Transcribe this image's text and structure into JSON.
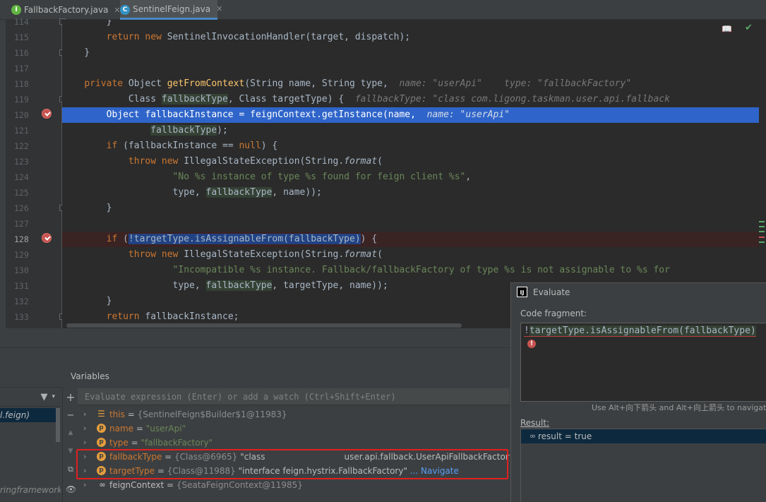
{
  "tabs": [
    {
      "label": "FallbackFactory.java",
      "icon": "interface-icon",
      "icon_letter": "I"
    },
    {
      "label": "SentinelFeign.java",
      "icon": "class-icon",
      "icon_letter": "C"
    }
  ],
  "editor": {
    "line_numbers": [
      "114",
      "115",
      "116",
      "117",
      "118",
      "119",
      "120",
      "121",
      "122",
      "123",
      "124",
      "125",
      "126",
      "127",
      "128",
      "129",
      "130",
      "131",
      "132",
      "133"
    ],
    "current_line": "128",
    "executing_line": "120",
    "breakpoint_lines": [
      "120",
      "128"
    ],
    "code": {
      "l114": "        }",
      "l115a": "        ",
      "l115b": "return",
      "l115c": " ",
      "l115d": "new",
      "l115e": " SentinelInvocationHandler(target, dispatch);",
      "l116": "    }",
      "l118a": "    ",
      "l118b": "private",
      "l118c": " Object ",
      "l118d": "getFromContext",
      "l118e": "(String name, String type,  ",
      "l118f": "name: \"userApi\"    type: \"fallbackFactory\"",
      "l119a": "            Class ",
      "l119b": "fallbackType",
      "l119c": ", Class targetType) {  ",
      "l119d": "fallbackType: \"class com.ligong.taskman.user.api.fallback",
      "l120a": "        Object ",
      "l120b": "fallbackInstance",
      "l120c": " = ",
      "l120d": "feignContext",
      "l120e": ".getInstance(name,  ",
      "l120f": "name: \"userApi\"",
      "l121a": "                ",
      "l121b": "fallbackType",
      "l121c": ");",
      "l122a": "        ",
      "l122b": "if",
      "l122c": " (fallbackInstance == ",
      "l122d": "null",
      "l122e": ") {",
      "l123a": "            ",
      "l123b": "throw",
      "l123c": " ",
      "l123d": "new",
      "l123e": " IllegalStateException(String.",
      "l123f": "format",
      "l123g": "(",
      "l124a": "                    ",
      "l124b": "\"No %s instance of type %s found for feign client %s\"",
      "l124c": ",",
      "l125a": "                    type, ",
      "l125b": "fallbackType",
      "l125c": ", name));",
      "l126": "        }",
      "l128a": "        ",
      "l128b": "if",
      "l128c": " (",
      "l128d": "!targetType.isAssignableFrom(fallbackType)",
      "l128e": ") {",
      "l129a": "            ",
      "l129b": "throw",
      "l129c": " ",
      "l129d": "new",
      "l129e": " IllegalStateException(String.",
      "l129f": "format",
      "l129g": "(",
      "l130a": "                    ",
      "l130b": "\"Incompatible %s instance. Fallback/fallbackFactory of type %s is not assignable to %s for",
      "l131a": "                    type, ",
      "l131b": "fallbackType",
      "l131c": ", targetType, name));",
      "l132": "        }",
      "l133a": "        ",
      "l133b": "return",
      "l133c": " fallbackInstance;"
    }
  },
  "debug": {
    "variables_title": "Variables",
    "watch_placeholder": "Evaluate expression (Enter) or add a watch (Ctrl+Shift+Enter)",
    "frame_label": "l.feign)",
    "frame_label2": "ringframework",
    "variables": [
      {
        "icon": "field-lines-icon",
        "name": "this",
        "type": "{SentinelFeign$Builder$1@11983}",
        "value": ""
      },
      {
        "icon": "parameter-icon",
        "name": "name",
        "type": "",
        "value": "\"userApi\""
      },
      {
        "icon": "parameter-icon",
        "name": "type",
        "type": "",
        "value": "\"fallbackFactory\""
      },
      {
        "icon": "parameter-icon",
        "name": "fallbackType",
        "type": "{Class@6965}",
        "value": "\"class",
        "value2": "user.api.fallback.UserApiFallbackFactory\""
      },
      {
        "icon": "parameter-icon",
        "name": "targetType",
        "type": "{Class@11988}",
        "value": "\"interface feign.hystrix.FallbackFactory\"",
        "link": "... Navigate"
      },
      {
        "icon": "watch-glasses-icon",
        "name": "feignContext",
        "type": "{SeataFeignContext@11985}",
        "value": ""
      }
    ]
  },
  "evaluate": {
    "title": "Evaluate",
    "code_label": "Code fragment:",
    "code_prefix": "!",
    "code_rest": "targetType.isAssignableFrom(fallbackType)",
    "nav_hint": "Use Alt+向下箭头 and Alt+向上箭头 to navigate",
    "result_label": "Result:",
    "result_name": "result",
    "result_eq": " = ",
    "result_value": "true"
  }
}
